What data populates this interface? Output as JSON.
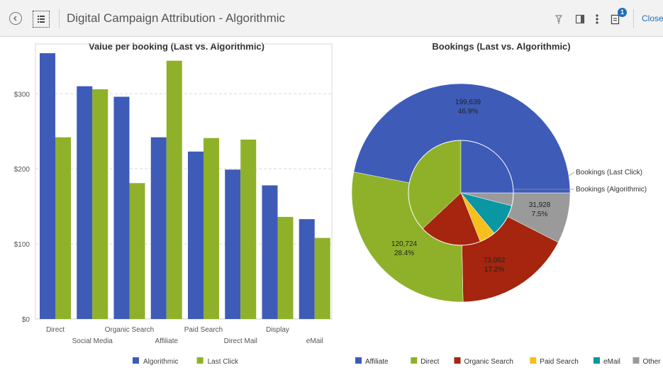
{
  "toolbar": {
    "title": "Digital Campaign Attribution - Algorithmic",
    "close_label": "Close",
    "notification_count": "1",
    "icons": [
      "back-icon",
      "list-menu-icon",
      "pin-icon",
      "side-panel-icon",
      "more-vertical-icon",
      "notes-icon"
    ]
  },
  "colors": {
    "algorithmic": "#3e5bb8",
    "last_click": "#8fb129",
    "affiliate": "#3e5bb8",
    "direct": "#8fb129",
    "organic_search": "#a5250e",
    "paid_search": "#f7bf1d",
    "email": "#0a96a3",
    "other": "#9a9a9a",
    "accent": "#1f6fb8"
  },
  "chart_data": [
    {
      "type": "bar",
      "title": "Value per booking (Last vs. Algorithmic)",
      "categories": [
        "Direct",
        "Social Media",
        "Organic Search",
        "Affiliate",
        "Paid Search",
        "Direct Mail",
        "Display",
        "eMail"
      ],
      "series": [
        {
          "name": "Algorithmic",
          "values": [
            354,
            310,
            296,
            242,
            223,
            199,
            178,
            133
          ]
        },
        {
          "name": "Last Click",
          "values": [
            242,
            306,
            181,
            344,
            241,
            239,
            136,
            108
          ]
        }
      ],
      "yticks": [
        0,
        100,
        200,
        300
      ],
      "ytick_labels": [
        "$0",
        "$100",
        "$200",
        "$300"
      ],
      "ylim": [
        0,
        355
      ],
      "grid": true,
      "legend": "bottom"
    },
    {
      "type": "pie",
      "title": "Bookings (Last vs. Algorithmic)",
      "categories": [
        "Affiliate",
        "Direct",
        "Organic Search",
        "Paid Search",
        "eMail",
        "Other"
      ],
      "series": [
        {
          "name": "Bookings (Last Click)",
          "values": [
            199639,
            120724,
            73062,
            0,
            0,
            31928
          ],
          "percents": [
            46.9,
            28.4,
            17.2,
            0,
            0,
            7.5
          ]
        },
        {
          "name": "Bookings (Algorithmic)",
          "values": [
            25,
            37,
            19,
            5,
            10,
            4
          ]
        }
      ],
      "labels": [
        {
          "value": "199,639",
          "percent": "46.9%"
        },
        {
          "value": "120,724",
          "percent": "28.4%"
        },
        {
          "value": "73,062",
          "percent": "17.2%"
        },
        {
          "value": "31,928",
          "percent": "7.5%"
        }
      ],
      "legend": "bottom"
    }
  ]
}
